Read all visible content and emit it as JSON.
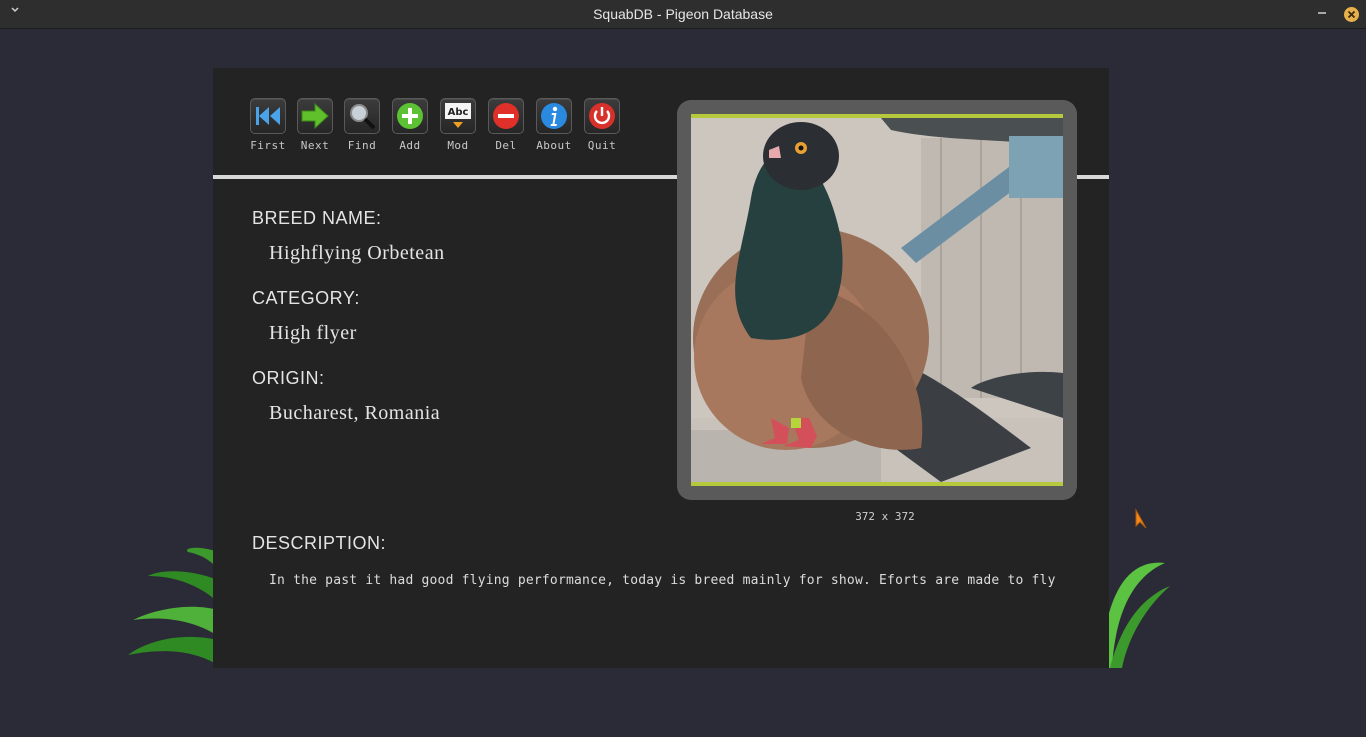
{
  "window": {
    "title": "SquabDB - Pigeon Database",
    "menu_icon": "chevron-down-icon",
    "minimize_icon": "minimize-icon",
    "close_icon": "close-icon"
  },
  "toolbar": {
    "buttons": [
      {
        "label": "First",
        "icon": "skip-first-icon"
      },
      {
        "label": "Next",
        "icon": "arrow-right-icon"
      },
      {
        "label": "Find",
        "icon": "magnifier-icon"
      },
      {
        "label": "Add",
        "icon": "plus-icon"
      },
      {
        "label": "Mod",
        "icon": "edit-text-icon"
      },
      {
        "label": "Del",
        "icon": "minus-icon"
      },
      {
        "label": "About",
        "icon": "info-icon"
      },
      {
        "label": "Quit",
        "icon": "power-icon"
      }
    ],
    "mod_icon_text": "Abc"
  },
  "record": {
    "breed_name_label": "BREED NAME:",
    "breed_name": "Highflying Orbetean",
    "category_label": "CATEGORY:",
    "category": "High flyer",
    "origin_label": "ORIGIN:",
    "origin": "Bucharest, Romania",
    "description_label": "DESCRIPTION:",
    "description": "In the past it had good flying performance, today is breed mainly for show. Eforts are made to fly"
  },
  "image": {
    "dimensions_text": "372 x 372",
    "subject": "pigeon-photo"
  },
  "colors": {
    "background": "#2b2a37",
    "panel": "#232323",
    "accent_border": "#b6c93c",
    "divider": "#d8d8d8"
  }
}
